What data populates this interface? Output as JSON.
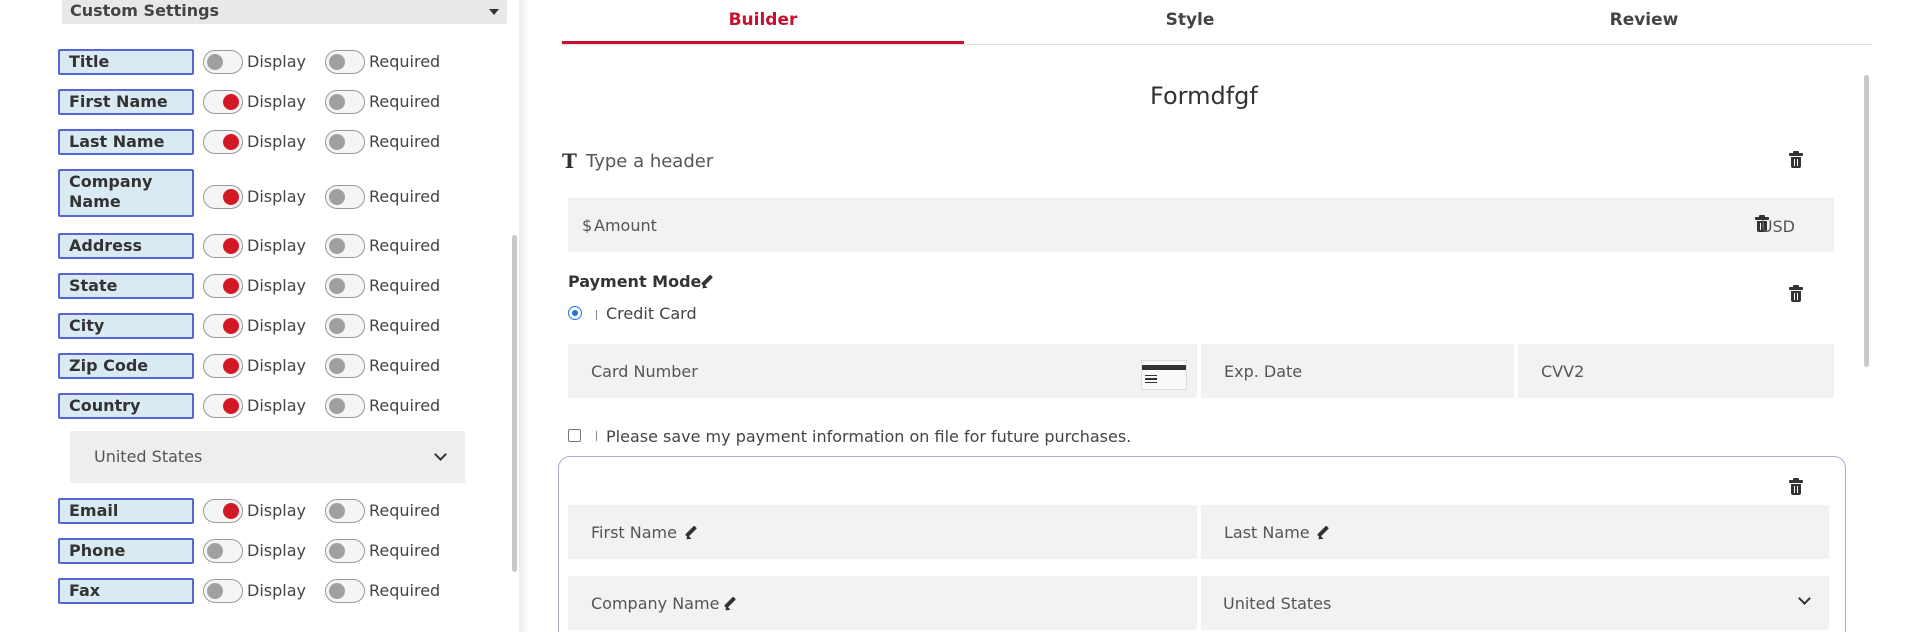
{
  "sidebar": {
    "section_title": "Custom Settings",
    "display_label": "Display",
    "required_label": "Required",
    "fields": [
      {
        "label": "Title",
        "display": false,
        "required": false
      },
      {
        "label": "First Name",
        "display": true,
        "required": false
      },
      {
        "label": "Last Name",
        "display": true,
        "required": false
      },
      {
        "label": "Company Name",
        "display": true,
        "required": false
      },
      {
        "label": "Address",
        "display": true,
        "required": false
      },
      {
        "label": "State",
        "display": true,
        "required": false
      },
      {
        "label": "City",
        "display": true,
        "required": false
      },
      {
        "label": "Zip Code",
        "display": true,
        "required": false
      },
      {
        "label": "Country",
        "display": true,
        "required": false
      },
      {
        "label": "Email",
        "display": true,
        "required": false
      },
      {
        "label": "Phone",
        "display": false,
        "required": false
      },
      {
        "label": "Fax",
        "display": false,
        "required": false
      }
    ],
    "country_select": {
      "value": "United States"
    }
  },
  "tabs": [
    {
      "label": "Builder",
      "active": true
    },
    {
      "label": "Style",
      "active": false
    },
    {
      "label": "Review",
      "active": false
    }
  ],
  "form": {
    "title": "Formdfgf",
    "header_placeholder": "Type a header",
    "amount": {
      "currency_symbol": "$",
      "placeholder": "Amount",
      "currency": "USD"
    },
    "payment_mode": {
      "label": "Payment Mode",
      "option": "Credit Card"
    },
    "card_fields": {
      "card_number": "Card Number",
      "exp_date": "Exp. Date",
      "cvv": "CVV2"
    },
    "save_payment_text": "Please save my payment information on file for future purchases.",
    "contact": {
      "first_name": "First Name",
      "last_name": "Last Name",
      "company_name": "Company Name",
      "country": "United States"
    }
  },
  "colors": {
    "accent": "#c8102e",
    "toggle_on": "#d31925",
    "field_label_bg": "#d9eaf2",
    "field_label_border": "#5467d4",
    "radio": "#1a73e8"
  }
}
